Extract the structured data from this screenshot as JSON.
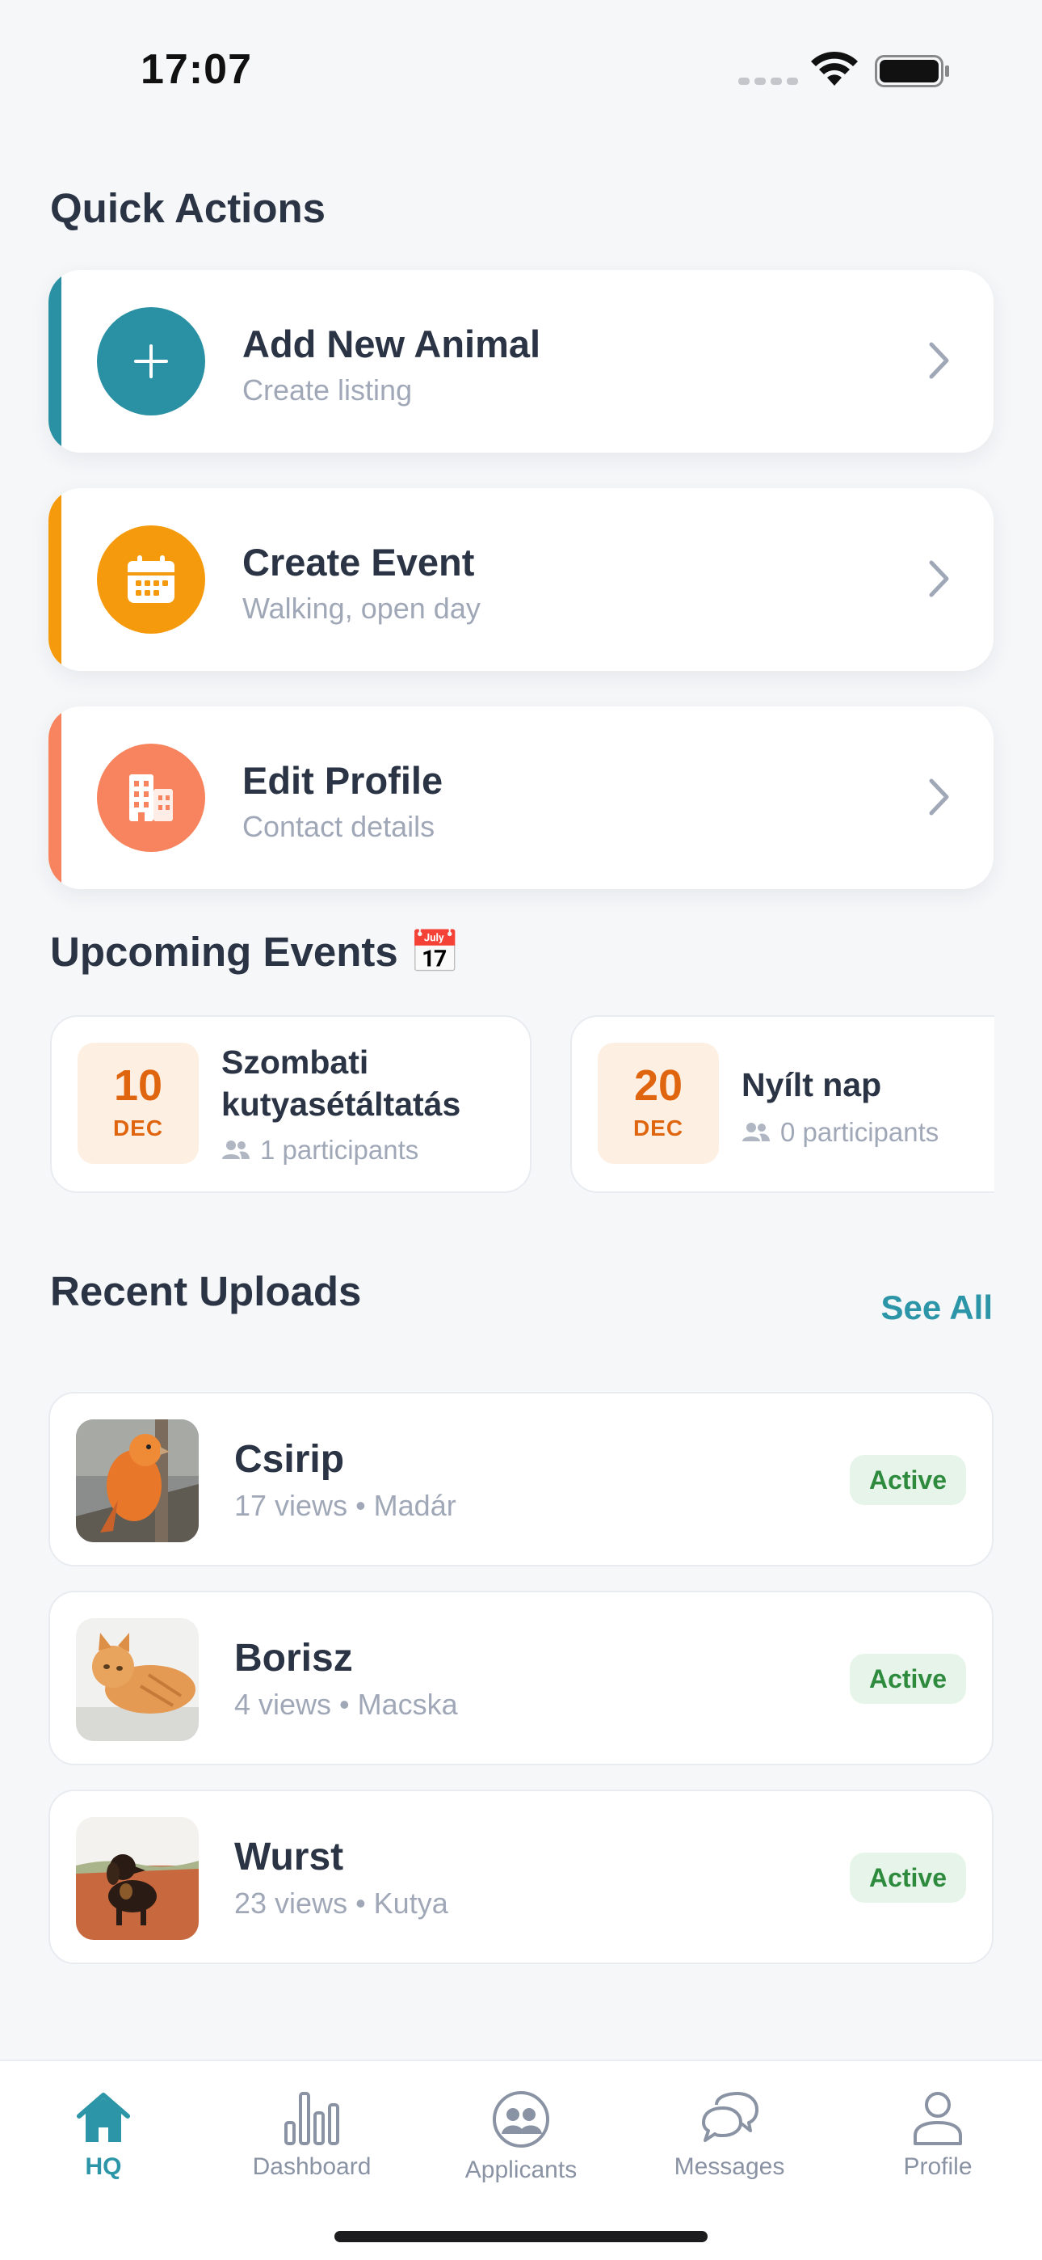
{
  "status": {
    "time": "17:07"
  },
  "quick_actions": {
    "title": "Quick Actions",
    "items": [
      {
        "title": "Add New Animal",
        "subtitle": "Create listing",
        "icon": "plus-icon",
        "color": "#2a90a4"
      },
      {
        "title": "Create Event",
        "subtitle": "Walking, open day",
        "icon": "calendar-icon",
        "color": "#f59a0c"
      },
      {
        "title": "Edit Profile",
        "subtitle": "Contact details",
        "icon": "building-icon",
        "color": "#f7845e"
      }
    ]
  },
  "events": {
    "title": "Upcoming Events 📅",
    "items": [
      {
        "day": "10",
        "month": "DEC",
        "title_line1": "Szombati",
        "title_line2": "kutyasétáltatás",
        "participants": "1 participants"
      },
      {
        "day": "20",
        "month": "DEC",
        "title": "Nyílt nap",
        "participants": "0 participants"
      }
    ]
  },
  "uploads": {
    "title": "Recent Uploads",
    "see_all": "See All",
    "items": [
      {
        "name": "Csirip",
        "views": "17 views",
        "category": "Madár",
        "status": "Active",
        "photo": "bird-photo"
      },
      {
        "name": "Borisz",
        "views": "4 views",
        "category": "Macska",
        "status": "Active",
        "photo": "cat-photo"
      },
      {
        "name": "Wurst",
        "views": "23 views",
        "category": "Kutya",
        "status": "Active",
        "photo": "dog-photo"
      }
    ]
  },
  "tabs": [
    {
      "label": "HQ",
      "icon": "home-icon",
      "active": true
    },
    {
      "label": "Dashboard",
      "icon": "bar-chart-icon"
    },
    {
      "label": "Applicants",
      "icon": "users-icon"
    },
    {
      "label": "Messages",
      "icon": "chat-icon"
    },
    {
      "label": "Profile",
      "icon": "person-icon"
    }
  ],
  "colors": {
    "accent": "#2c96a8",
    "background": "#f6f7f9",
    "active_badge": "#e6f4ea"
  }
}
